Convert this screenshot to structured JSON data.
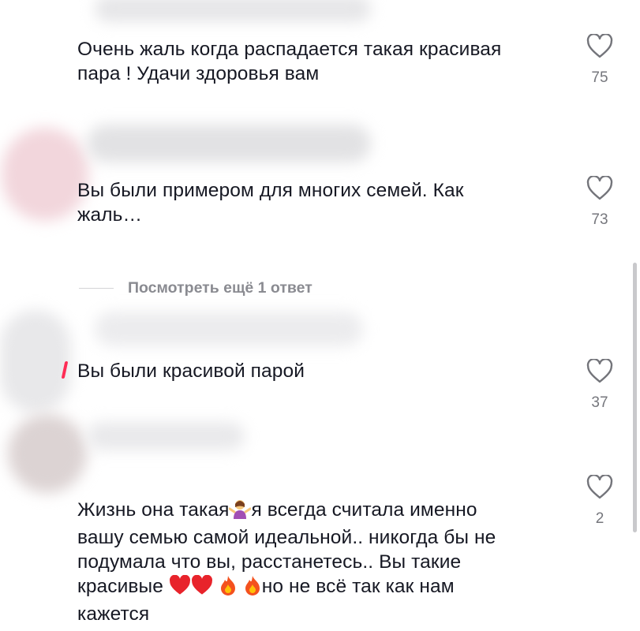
{
  "comments": [
    {
      "text": "Очень жаль когда распадается такая красивая\nпара ! Удачи здоровья вам",
      "likes": "75"
    },
    {
      "text": "Вы были примером для многих семей. Как\nжаль…",
      "likes": "73"
    },
    {
      "text": "Вы были красивой парой",
      "likes": "37"
    },
    {
      "text_line1_a": "Жизнь она такая",
      "text_line1_b": "я всегда считала именно",
      "text_line2": "вашу семью самой идеальной.. никогда бы не",
      "text_line3": "подумала что вы, расстанетесь.. Вы такие",
      "text_line4_a": "красивые",
      "text_line4_b": "но не всё так как нам",
      "text_line5": "кажется",
      "likes": "2"
    }
  ],
  "replies": {
    "view_more_label": "Посмотреть ещё 1 ответ"
  },
  "icons": {
    "like": "heart-outline-icon",
    "emoji_shrug": "woman-shrugging-emoji",
    "emoji_heart": "red-heart-emoji",
    "emoji_fire": "fire-emoji"
  },
  "colors": {
    "text": "#161823",
    "secondary": "#75767c",
    "accent": "#fe2c55"
  }
}
